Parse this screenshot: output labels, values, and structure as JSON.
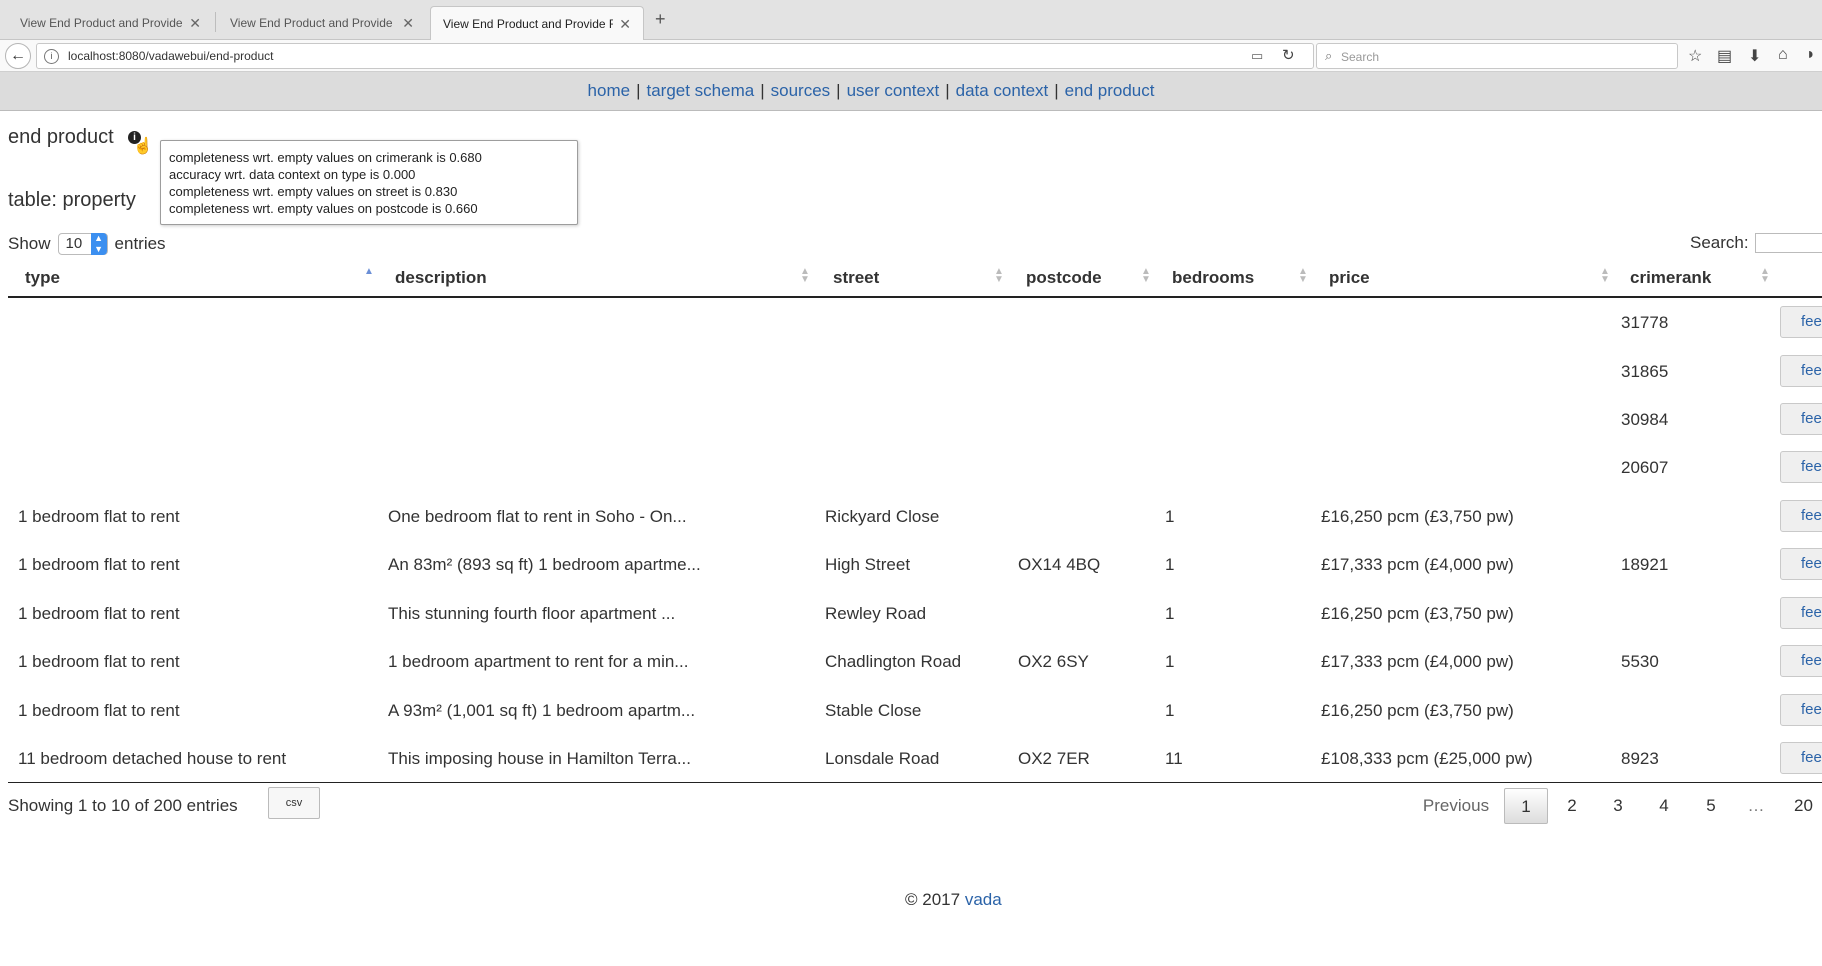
{
  "browser": {
    "tabs": [
      {
        "title": "View End Product and Provide Fe"
      },
      {
        "title": "View End Product and Provide Fe"
      },
      {
        "title": "View End Product and Provide Fe"
      }
    ],
    "new_tab": "+",
    "url": "localhost:8080/vadawebui/end-product",
    "search_placeholder": "Search"
  },
  "appnav": {
    "items": [
      "home",
      "target schema",
      "sources",
      "user context",
      "data context",
      "end product"
    ],
    "separator": "|"
  },
  "page": {
    "title": "end product",
    "info_glyph": "i",
    "tooltip": [
      "completeness wrt. empty values on crimerank is 0.680",
      "accuracy wrt. data context on type is 0.000",
      "completeness wrt. empty values on street is 0.830",
      "completeness wrt. empty values on postcode is 0.660"
    ],
    "table_title": "table: property"
  },
  "controls": {
    "show_label": "Show",
    "entries_value": "10",
    "entries_label": "entries",
    "search_label": "Search:"
  },
  "table": {
    "columns": [
      "type",
      "description",
      "street",
      "postcode",
      "bedrooms",
      "price",
      "crimerank"
    ],
    "feedback_label": "feedback",
    "rows": [
      [
        "",
        "",
        "",
        "",
        "",
        "",
        "31778"
      ],
      [
        "",
        "",
        "",
        "",
        "",
        "",
        "31865"
      ],
      [
        "",
        "",
        "",
        "",
        "",
        "",
        "30984"
      ],
      [
        "",
        "",
        "",
        "",
        "",
        "",
        "20607"
      ],
      [
        "1 bedroom flat to rent",
        "One bedroom flat to rent in Soho - On...",
        "Rickyard Close",
        "",
        "1",
        "£16,250 pcm (£3,750 pw)",
        ""
      ],
      [
        "1 bedroom flat to rent",
        "An 83m² (893 sq ft) 1 bedroom apartme...",
        "High Street",
        "OX14 4BQ",
        "1",
        "£17,333 pcm (£4,000 pw)",
        "18921"
      ],
      [
        "1 bedroom flat to rent",
        "This stunning fourth floor apartment ...",
        "Rewley Road",
        "",
        "1",
        "£16,250 pcm (£3,750 pw)",
        ""
      ],
      [
        "1 bedroom flat to rent",
        "1 bedroom apartment to rent for a min...",
        "Chadlington Road",
        "OX2 6SY",
        "1",
        "£17,333 pcm (£4,000 pw)",
        "5530"
      ],
      [
        "1 bedroom flat to rent",
        "A 93m² (1,001 sq ft) 1 bedroom apartm...",
        "Stable Close",
        "",
        "1",
        "£16,250 pcm (£3,750 pw)",
        ""
      ],
      [
        "11 bedroom detached house to rent",
        "This imposing house in Hamilton Terra...",
        "Lonsdale Road",
        "OX2 7ER",
        "11",
        "£108,333 pcm (£25,000 pw)",
        "8923"
      ]
    ]
  },
  "footer_bar": {
    "info": "Showing 1 to 10 of 200 entries",
    "csv_label": "csv",
    "pagination": {
      "previous": "Previous",
      "pages": [
        "1",
        "2",
        "3",
        "4",
        "5",
        "…",
        "20"
      ],
      "current": "1"
    }
  },
  "footer": {
    "copyright": "© 2017",
    "link": "vada"
  },
  "colors": {
    "link": "#2b63a8",
    "nav_background": "#dcdcdc",
    "select_accent": "#3b8ff0"
  }
}
